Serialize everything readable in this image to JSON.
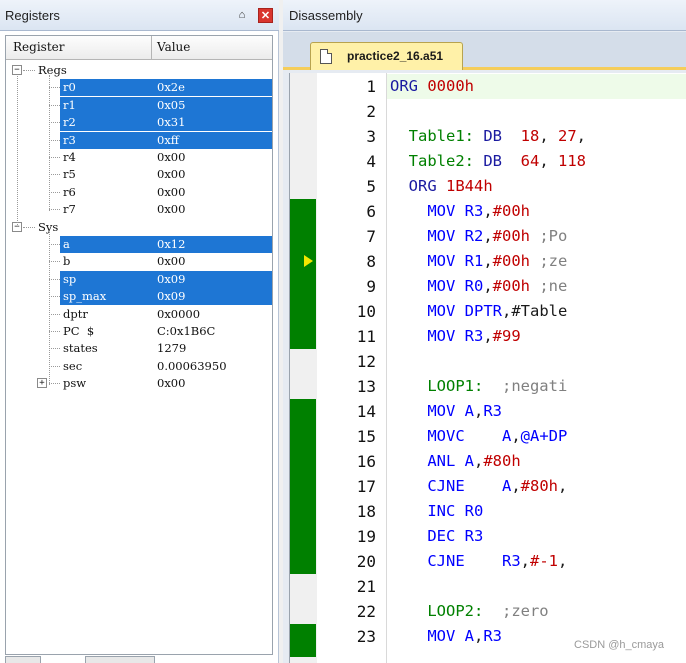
{
  "registers_pane": {
    "title": "Registers",
    "pin_glyph": "⌂",
    "close_glyph": "✕",
    "header": {
      "col_register": "Register",
      "col_value": "Value"
    },
    "groups": [
      {
        "name": "Regs",
        "expander": "−",
        "items": [
          {
            "name": "r0",
            "value": "0x2e",
            "selected": true
          },
          {
            "name": "r1",
            "value": "0x05",
            "selected": true
          },
          {
            "name": "r2",
            "value": "0x31",
            "selected": true
          },
          {
            "name": "r3",
            "value": "0xff",
            "selected": true
          },
          {
            "name": "r4",
            "value": "0x00",
            "selected": false
          },
          {
            "name": "r5",
            "value": "0x00",
            "selected": false
          },
          {
            "name": "r6",
            "value": "0x00",
            "selected": false
          },
          {
            "name": "r7",
            "value": "0x00",
            "selected": false
          }
        ]
      },
      {
        "name": "Sys",
        "expander": "−",
        "items": [
          {
            "name": "a",
            "value": "0x12",
            "selected": true
          },
          {
            "name": "b",
            "value": "0x00",
            "selected": false
          },
          {
            "name": "sp",
            "value": "0x09",
            "selected": true
          },
          {
            "name": "sp_max",
            "value": "0x09",
            "selected": true
          },
          {
            "name": "dptr",
            "value": "0x0000",
            "selected": false
          },
          {
            "name": "PC  $",
            "value": "C:0x1B6C",
            "selected": false
          },
          {
            "name": "states",
            "value": "1279",
            "selected": false
          },
          {
            "name": "sec",
            "value": "0.00063950",
            "selected": false
          },
          {
            "name": "psw",
            "value": "0x00",
            "selected": false,
            "expander": "+"
          }
        ]
      }
    ]
  },
  "disassembly_pane": {
    "title": "Disassembly",
    "file_tab": "practice2_16.a51",
    "icons": {
      "file_tab": "file-icon",
      "current_line": "execution-arrow-icon"
    },
    "colors": {
      "coverage": "#008000",
      "keyword": "#0000ff",
      "label": "#008000",
      "number": "#c00000",
      "comment": "#808080",
      "selection": "#1e76d4"
    },
    "execution_line": 8,
    "lines": [
      {
        "n": "1",
        "covered": false,
        "code": [
          {
            "t": "ORG ",
            "c": "dir"
          },
          {
            "t": "0000h",
            "c": "num"
          }
        ]
      },
      {
        "n": "2",
        "covered": false,
        "code": []
      },
      {
        "n": "3",
        "covered": false,
        "code": [
          {
            "t": "  Table1: ",
            "c": "lbl"
          },
          {
            "t": "DB  ",
            "c": "dir"
          },
          {
            "t": "18",
            "c": "num"
          },
          {
            "t": ", ",
            "c": "txt"
          },
          {
            "t": "27",
            "c": "num"
          },
          {
            "t": ",",
            "c": "txt"
          }
        ]
      },
      {
        "n": "4",
        "covered": false,
        "code": [
          {
            "t": "  Table2: ",
            "c": "lbl"
          },
          {
            "t": "DB  ",
            "c": "dir"
          },
          {
            "t": "64",
            "c": "num"
          },
          {
            "t": ", ",
            "c": "txt"
          },
          {
            "t": "118",
            "c": "num"
          }
        ]
      },
      {
        "n": "5",
        "covered": false,
        "code": [
          {
            "t": "  ORG ",
            "c": "dir"
          },
          {
            "t": "1B44h",
            "c": "num"
          }
        ]
      },
      {
        "n": "6",
        "covered": true,
        "code": [
          {
            "t": "    MOV ",
            "c": "kw"
          },
          {
            "t": "R3",
            "c": "kw"
          },
          {
            "t": ",",
            "c": "txt"
          },
          {
            "t": "#00h",
            "c": "num"
          }
        ]
      },
      {
        "n": "7",
        "covered": true,
        "code": [
          {
            "t": "    MOV ",
            "c": "kw"
          },
          {
            "t": "R2",
            "c": "kw"
          },
          {
            "t": ",",
            "c": "txt"
          },
          {
            "t": "#00h",
            "c": "num"
          },
          {
            "t": " ;Po",
            "c": "cmt"
          }
        ]
      },
      {
        "n": "8",
        "covered": true,
        "code": [
          {
            "t": "    MOV ",
            "c": "kw"
          },
          {
            "t": "R1",
            "c": "kw"
          },
          {
            "t": ",",
            "c": "txt"
          },
          {
            "t": "#00h",
            "c": "num"
          },
          {
            "t": " ;ze",
            "c": "cmt"
          }
        ]
      },
      {
        "n": "9",
        "covered": true,
        "code": [
          {
            "t": "    MOV ",
            "c": "kw"
          },
          {
            "t": "R0",
            "c": "kw"
          },
          {
            "t": ",",
            "c": "txt"
          },
          {
            "t": "#00h",
            "c": "num"
          },
          {
            "t": " ;ne",
            "c": "cmt"
          }
        ]
      },
      {
        "n": "10",
        "covered": true,
        "code": [
          {
            "t": "    MOV ",
            "c": "kw"
          },
          {
            "t": "DPTR",
            "c": "kw"
          },
          {
            "t": ",",
            "c": "txt"
          },
          {
            "t": "#Table",
            "c": "txt"
          }
        ]
      },
      {
        "n": "11",
        "covered": true,
        "code": [
          {
            "t": "    MOV ",
            "c": "kw"
          },
          {
            "t": "R3",
            "c": "kw"
          },
          {
            "t": ",",
            "c": "txt"
          },
          {
            "t": "#99",
            "c": "num"
          }
        ]
      },
      {
        "n": "12",
        "covered": false,
        "code": []
      },
      {
        "n": "13",
        "covered": false,
        "code": [
          {
            "t": "    LOOP1:  ",
            "c": "lbl"
          },
          {
            "t": ";negati",
            "c": "cmt"
          }
        ]
      },
      {
        "n": "14",
        "covered": true,
        "code": [
          {
            "t": "    MOV ",
            "c": "kw"
          },
          {
            "t": "A",
            "c": "kw"
          },
          {
            "t": ",",
            "c": "txt"
          },
          {
            "t": "R3",
            "c": "kw"
          }
        ]
      },
      {
        "n": "15",
        "covered": true,
        "code": [
          {
            "t": "    MOVC    ",
            "c": "kw"
          },
          {
            "t": "A",
            "c": "kw"
          },
          {
            "t": ",",
            "c": "txt"
          },
          {
            "t": "@A+DP",
            "c": "kw"
          }
        ]
      },
      {
        "n": "16",
        "covered": true,
        "code": [
          {
            "t": "    ANL ",
            "c": "kw"
          },
          {
            "t": "A",
            "c": "kw"
          },
          {
            "t": ",",
            "c": "txt"
          },
          {
            "t": "#80h",
            "c": "num"
          }
        ]
      },
      {
        "n": "17",
        "covered": true,
        "code": [
          {
            "t": "    CJNE    ",
            "c": "kw"
          },
          {
            "t": "A",
            "c": "kw"
          },
          {
            "t": ",",
            "c": "txt"
          },
          {
            "t": "#80h",
            "c": "num"
          },
          {
            "t": ",",
            "c": "txt"
          }
        ]
      },
      {
        "n": "18",
        "covered": true,
        "code": [
          {
            "t": "    INC ",
            "c": "kw"
          },
          {
            "t": "R0",
            "c": "kw"
          }
        ]
      },
      {
        "n": "19",
        "covered": true,
        "code": [
          {
            "t": "    DEC ",
            "c": "kw"
          },
          {
            "t": "R3",
            "c": "kw"
          }
        ]
      },
      {
        "n": "20",
        "covered": true,
        "code": [
          {
            "t": "    CJNE    ",
            "c": "kw"
          },
          {
            "t": "R3",
            "c": "kw"
          },
          {
            "t": ",",
            "c": "txt"
          },
          {
            "t": "#-1",
            "c": "num"
          },
          {
            "t": ",",
            "c": "txt"
          }
        ]
      },
      {
        "n": "21",
        "covered": false,
        "code": []
      },
      {
        "n": "22",
        "covered": false,
        "code": [
          {
            "t": "    LOOP2:  ",
            "c": "lbl"
          },
          {
            "t": ";zero",
            "c": "cmt"
          }
        ]
      },
      {
        "n": "23",
        "covered": true,
        "code": [
          {
            "t": "    MOV ",
            "c": "kw"
          },
          {
            "t": "A",
            "c": "kw"
          },
          {
            "t": ",",
            "c": "txt"
          },
          {
            "t": "R3",
            "c": "kw"
          }
        ]
      }
    ]
  },
  "watermark": "CSDN @h_cmaya"
}
